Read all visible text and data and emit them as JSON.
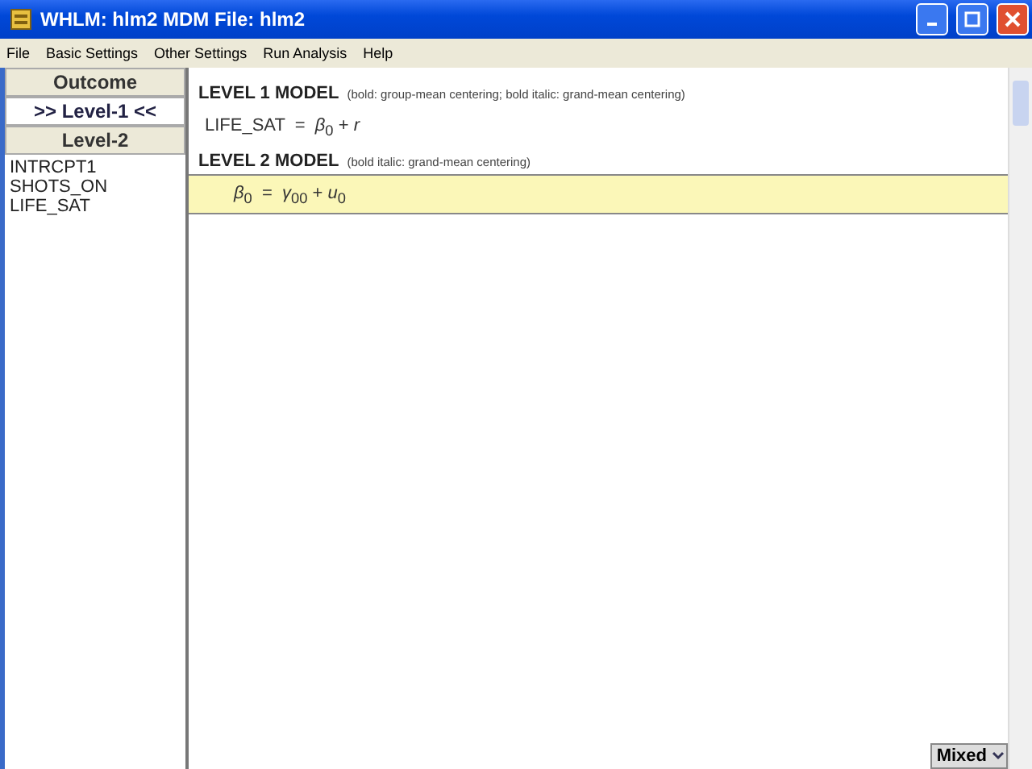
{
  "window": {
    "title": "WHLM: hlm2 MDM File: hlm2"
  },
  "menu": [
    "File",
    "Basic Settings",
    "Other Settings",
    "Run Analysis",
    "Help"
  ],
  "level_buttons": [
    {
      "label": "Outcome",
      "selected": false
    },
    {
      "label": ">> Level-1 <<",
      "selected": true
    },
    {
      "label": "Level-2",
      "selected": false
    }
  ],
  "variables": [
    "INTRCPT1",
    "SHOTS_ON",
    "LIFE_SAT"
  ],
  "level1": {
    "heading": "LEVEL 1 MODEL",
    "note": "(bold: group-mean centering; bold italic: grand-mean centering)",
    "equation": "LIFE_SAT  =  *β*$_{0}$ + *r*"
  },
  "level2": {
    "heading": "LEVEL 2 MODEL",
    "note": "(bold italic: grand-mean centering)",
    "equation": "*β*$_{0}$  =  *γ*$_{00}$ + *u*$_{0}$"
  },
  "mode_dropdown": {
    "value": "Mixed"
  }
}
